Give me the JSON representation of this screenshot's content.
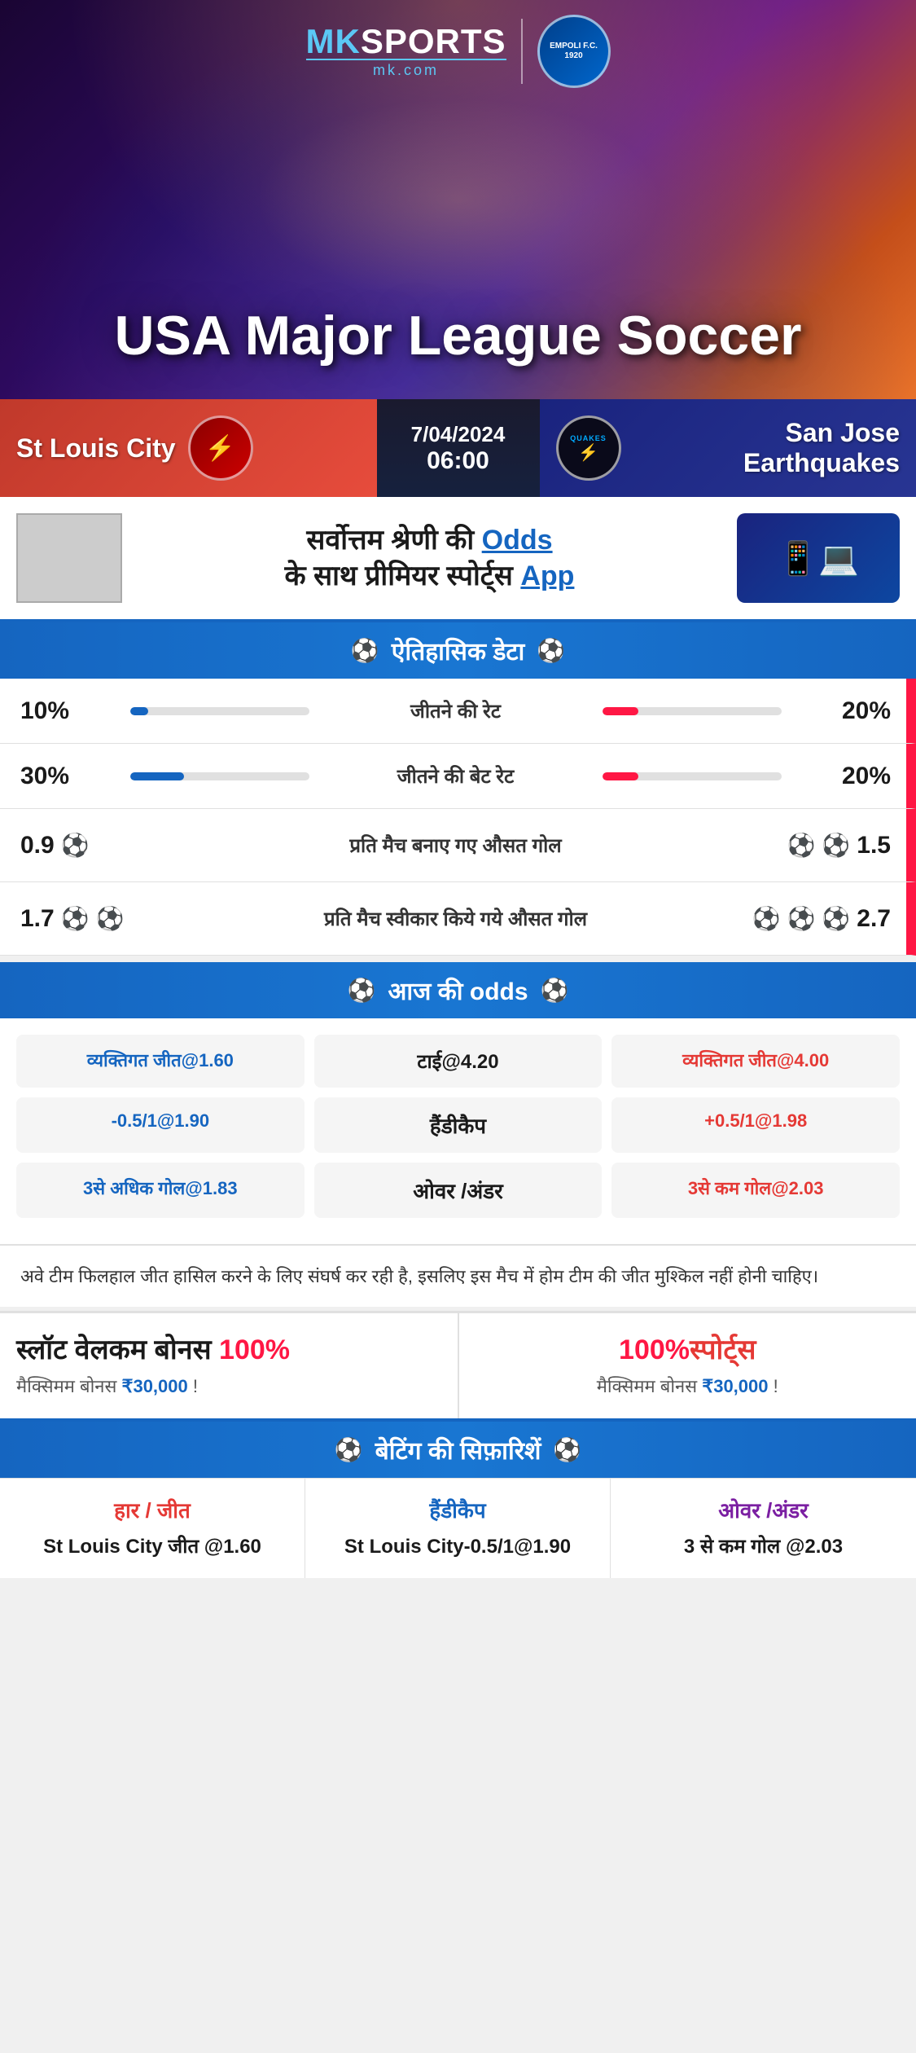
{
  "brand": {
    "name": "MK SPORTS",
    "sub": "mk.com",
    "partner": "EMPOLI F.C.\n1920"
  },
  "hero": {
    "title": "USA Major League Soccer"
  },
  "match": {
    "home_team": "St Louis City",
    "away_team": "San Jose Earthquakes",
    "away_team_short": "QUAKES",
    "date": "7/04/2024",
    "time": "06:00"
  },
  "promo": {
    "text": "सर्वोत्तम श्रेणी की Odds के साथ प्रीमियर स्पोर्ट्स App",
    "text_highlight": "Odds"
  },
  "sections": {
    "historical": "ऐतिहासिक डेटा",
    "odds": "आज की odds",
    "betting": "बेटिंग की सिफ़ारिशें"
  },
  "stats": [
    {
      "label": "जीतने की रेट",
      "left_val": "10%",
      "right_val": "20%",
      "left_pct": 10,
      "right_pct": 20
    },
    {
      "label": "जीतने की बेट रेट",
      "left_val": "30%",
      "right_val": "20%",
      "left_pct": 30,
      "right_pct": 20
    }
  ],
  "goals": [
    {
      "label": "प्रति मैच बनाए गए औसत गोल",
      "left_val": "0.9",
      "right_val": "1.5",
      "left_balls": 1,
      "right_balls": 2
    },
    {
      "label": "प्रति मैच स्वीकार किये गये औसत गोल",
      "left_val": "1.7",
      "right_val": "2.7",
      "left_balls": 2,
      "right_balls": 3
    }
  ],
  "odds": {
    "row1": {
      "left": "व्यक्तिगत जीत@1.60",
      "center": "टाई@4.20",
      "right": "व्यक्तिगत जीत@4.00"
    },
    "row2": {
      "left": "-0.5/1@1.90",
      "center": "हैंडीकैप",
      "right": "+0.5/1@1.98"
    },
    "row3": {
      "left": "3से अधिक गोल@1.83",
      "center": "ओवर /अंडर",
      "right": "3से कम गोल@2.03"
    }
  },
  "commentary": "अवे टीम फिलहाल जीत हासिल करने के लिए संघर्ष कर रही है, इसलिए इस मैच में होम टीम की जीत मुश्किल नहीं होनी चाहिए।",
  "bonus": {
    "left_title": "स्लॉट वेलकम बोनस 100%",
    "left_highlight": "100%",
    "left_sub": "मैक्सिमम बोनस ₹30,000  !",
    "right_title": "100%स्पोर्ट्स",
    "right_highlight": "100%",
    "right_sub": "मैक्सिमम बोनस  ₹30,000 !"
  },
  "recommendations": [
    {
      "type": "हार / जीत",
      "color": "red",
      "value": "St Louis City जीत @1.60"
    },
    {
      "type": "हैंडीकैप",
      "color": "blue",
      "value": "St Louis City-0.5/1@1.90"
    },
    {
      "type": "ओवर /अंडर",
      "color": "purple",
      "value": "3 से कम गोल @2.03"
    }
  ]
}
